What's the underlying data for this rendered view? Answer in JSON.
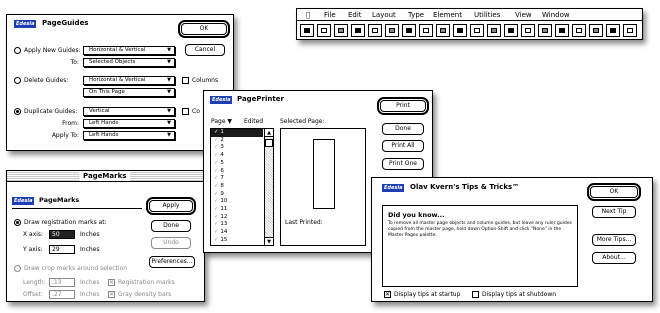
{
  "menubar": {
    "apple": "",
    "items": [
      "File",
      "Edit",
      "Layout",
      "Type",
      "Element",
      "Utilities",
      "View",
      "Window"
    ],
    "tool_icons": [
      "page-tool-icon",
      "save-tool-icon",
      "cut-tool-icon",
      "copy-tool-icon",
      "paste-tool-icon",
      "check-tool-icon",
      "text-tool-icon",
      "columns-tool-icon",
      "grid-tool-icon",
      "frame-tool-icon",
      "link-tool-icon",
      "align-tool-icon",
      "rotate-tool-icon",
      "group-tool-icon",
      "layers-tool-icon",
      "picture-tool-icon",
      "view-tool-icon",
      "zoom-tool-icon",
      "window-tool-icon",
      "help-tool-icon"
    ]
  },
  "page_guides": {
    "logo": "Edesia",
    "title": "PageGuides",
    "ok": "OK",
    "cancel": "Cancel",
    "apply_new_label": "Apply New Guides:",
    "apply_new_value": "Horizontal & Vertical",
    "to_label": "To:",
    "to_value": "Selected Objects",
    "delete_label": "Delete Guides:",
    "delete_value": "Horizontal & Vertical",
    "delete_scope": "On This Page",
    "columns_label": "Columns",
    "duplicate_label": "Duplicate Guides:",
    "duplicate_value": "Vertical",
    "from_label": "From:",
    "from_value": "Left Hands",
    "apply_to_label": "Apply To:",
    "apply_to_value": "Left Hands",
    "col_partial": "Co"
  },
  "page_printer": {
    "logo": "Edesia",
    "title": "PagePrinter",
    "page_col": "Page ▼",
    "edited_col": "Edited",
    "selected_label": "Selected Page:",
    "pages": [
      "1",
      "2",
      "3",
      "4",
      "5",
      "6",
      "7",
      "8",
      "9",
      "10",
      "11",
      "12",
      "13",
      "14",
      "15"
    ],
    "last_printed_label": "Last Printed:",
    "print": "Print",
    "done": "Done",
    "print_all": "Print All",
    "print_one": "Print One"
  },
  "page_marks": {
    "window_title": "PageMarks",
    "logo": "Edesia",
    "title": "PageMarks",
    "apply": "Apply",
    "done": "Done",
    "undo": "Undo",
    "preferences": "Preferences...",
    "reg_label": "Draw registration marks at:",
    "x_label": "X axis:",
    "x_value": "50",
    "y_label": "Y axis:",
    "y_value": "29",
    "inches": "Inches",
    "crop_label": "Draw crop marks around selection",
    "length_label": "Length:",
    "length_value": ".13",
    "offset_label": "Offset:",
    "offset_value": ".27",
    "reg_marks_label": "Registration marks",
    "density_label": "Gray density bars"
  },
  "tips": {
    "logo": "Edesia",
    "title": "Olav Kvern's Tips & Tricks™",
    "did_you_know": "Did you know...",
    "tip_text": "To remove all master page objects and column guides, but leave any ruler guides copied from the master page, hold down Option-Shift and click \"None\" in the Master Pages palette.",
    "ok": "OK",
    "next_tip": "Next Tip",
    "more_tips": "More Tips...",
    "about": "About...",
    "startup_label": "Display tips at startup",
    "shutdown_label": "Display tips at shutdown"
  }
}
